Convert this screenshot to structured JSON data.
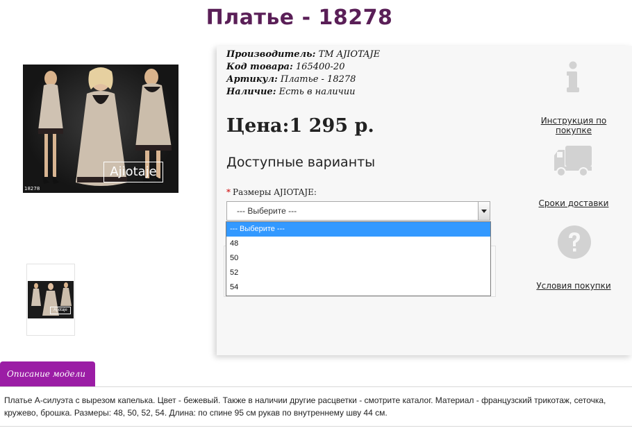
{
  "product": {
    "title": "Платье - 18278",
    "image_brand": "Ajiotaje",
    "image_code": "18278",
    "thumb_brand": "Ajiotaje"
  },
  "meta": {
    "manufacturer_label": "Производитель:",
    "manufacturer_value": "ТМ AJIOTAJE",
    "code_label": "Код товара:",
    "code_value": "165400-20",
    "sku_label": "Артикул:",
    "sku_value": "Платье - 18278",
    "stock_label": "Наличие:",
    "stock_value": "Есть в наличии"
  },
  "price": {
    "label": "Цена:",
    "value": "1 295 р."
  },
  "variants": {
    "title": "Доступные варианты",
    "required_mark": "*",
    "sizes_label": "Размеры AJIOTAJE:",
    "selected": "--- Выберите ---",
    "options": [
      "--- Выберите ---",
      "48",
      "50",
      "52",
      "54"
    ]
  },
  "side_links": {
    "instructions": "Инструкция по покупке",
    "delivery": "Сроки доставки",
    "terms": "Условия покупки"
  },
  "description": {
    "tab_label": "Описание модели",
    "text": "Платье А-силуэта с вырезом капелька. Цвет - бежевый. Также в наличии другие расцветки - смотрите каталог. Материал - французский трикотаж, сеточка, кружево, брошка. Размеры: 48, 50, 52, 54. Длина: по спине 95 см рукав по внутреннему шву 44 см."
  },
  "colors": {
    "title": "#5a1f57",
    "tab": "#9b1da5",
    "dropdown_highlight": "#3399ff",
    "icon_gray": "#d2d2d2"
  },
  "icons": [
    "info-icon",
    "truck-icon",
    "question-icon",
    "chevron-down-icon"
  ]
}
